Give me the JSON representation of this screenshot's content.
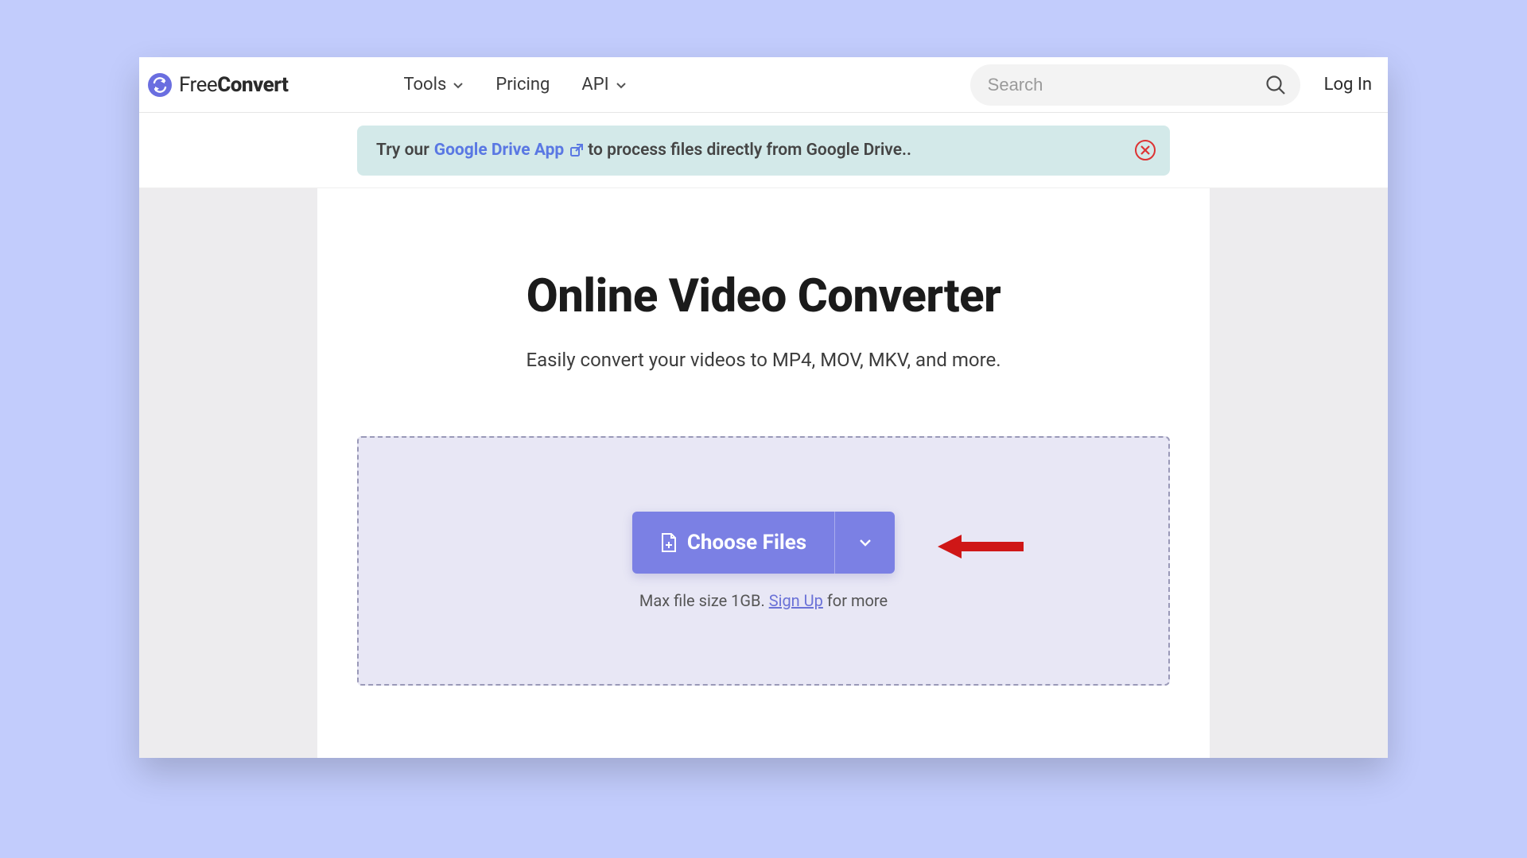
{
  "brand": {
    "part1": "Free",
    "part2": "Convert"
  },
  "nav": {
    "tools": "Tools",
    "pricing": "Pricing",
    "api": "API"
  },
  "search": {
    "placeholder": "Search"
  },
  "login": "Log In",
  "banner": {
    "prefix": "Try our",
    "link": "Google Drive App",
    "suffix": "to process files directly from Google Drive.."
  },
  "hero": {
    "title": "Online Video Converter",
    "subtitle": "Easily convert your videos to MP4, MOV, MKV, and more."
  },
  "upload": {
    "button": "Choose Files",
    "hint_prefix": "Max file size 1GB. ",
    "hint_link": "Sign Up",
    "hint_suffix": " for more"
  }
}
